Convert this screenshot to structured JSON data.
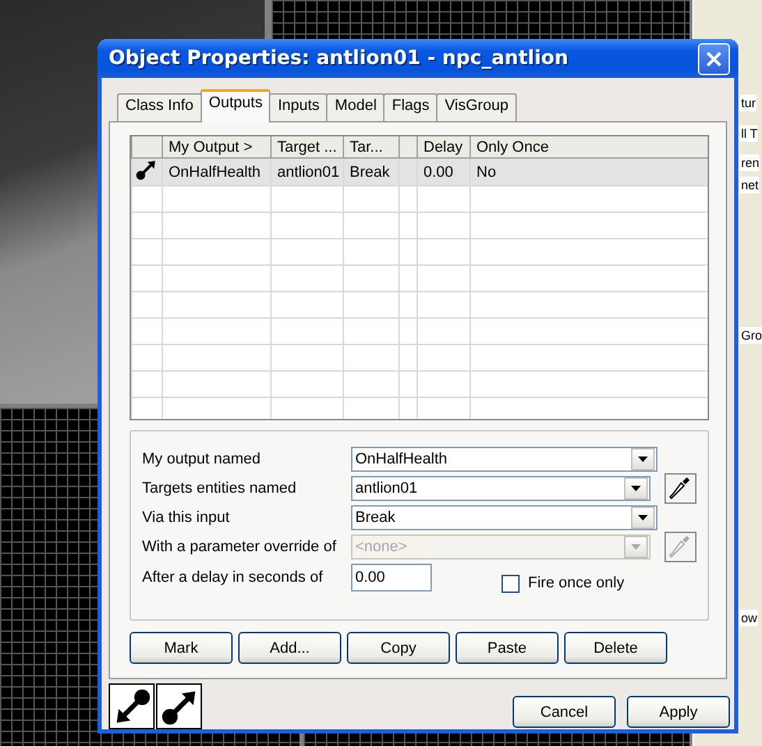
{
  "background": {
    "side_panel_labels": [
      "tur",
      "ll T",
      "ren",
      "net",
      "Gro",
      "ow"
    ]
  },
  "window": {
    "title": "Object Properties: antlion01 - npc_antlion"
  },
  "tabs": [
    {
      "label": "Class Info",
      "selected": false
    },
    {
      "label": "Outputs",
      "selected": true
    },
    {
      "label": "Inputs",
      "selected": false
    },
    {
      "label": "Model",
      "selected": false
    },
    {
      "label": "Flags",
      "selected": false
    },
    {
      "label": "VisGroup",
      "selected": false
    }
  ],
  "outputs_table": {
    "columns": [
      {
        "kind": "icon"
      },
      {
        "kind": "text",
        "label": "My Output >"
      },
      {
        "kind": "text",
        "label": "Target ..."
      },
      {
        "kind": "text",
        "label": "Tar..."
      },
      {
        "kind": "blank"
      },
      {
        "kind": "text",
        "label": "Delay"
      },
      {
        "kind": "text",
        "label": "Only Once"
      }
    ],
    "rows": [
      {
        "selected": true,
        "cells": [
          "",
          "OnHalfHealth",
          "antlion01",
          "Break",
          "",
          "0.00",
          "No"
        ]
      }
    ]
  },
  "form": {
    "fields": [
      {
        "kind": "combo",
        "label": "My output named",
        "value": "OnHalfHealth",
        "disabled": false,
        "picker": false
      },
      {
        "kind": "combo",
        "label": "Targets entities named",
        "value": "antlion01",
        "disabled": false,
        "picker": true
      },
      {
        "kind": "combo",
        "label": "Via this input",
        "value": "Break",
        "disabled": false,
        "picker": false
      },
      {
        "kind": "combo",
        "label": "With a parameter override of",
        "value": "<none>",
        "disabled": true,
        "picker": true
      },
      {
        "kind": "text",
        "label": "After a delay in seconds of",
        "value": "0.00",
        "disabled": false
      }
    ],
    "fire_once": {
      "label": "Fire once only",
      "checked": false
    }
  },
  "action_buttons": [
    "Mark",
    "Add...",
    "Copy",
    "Paste",
    "Delete"
  ],
  "mode_icons": [
    {
      "kind": "input"
    },
    {
      "kind": "output"
    }
  ],
  "dialog_buttons": [
    "Cancel",
    "Apply"
  ]
}
